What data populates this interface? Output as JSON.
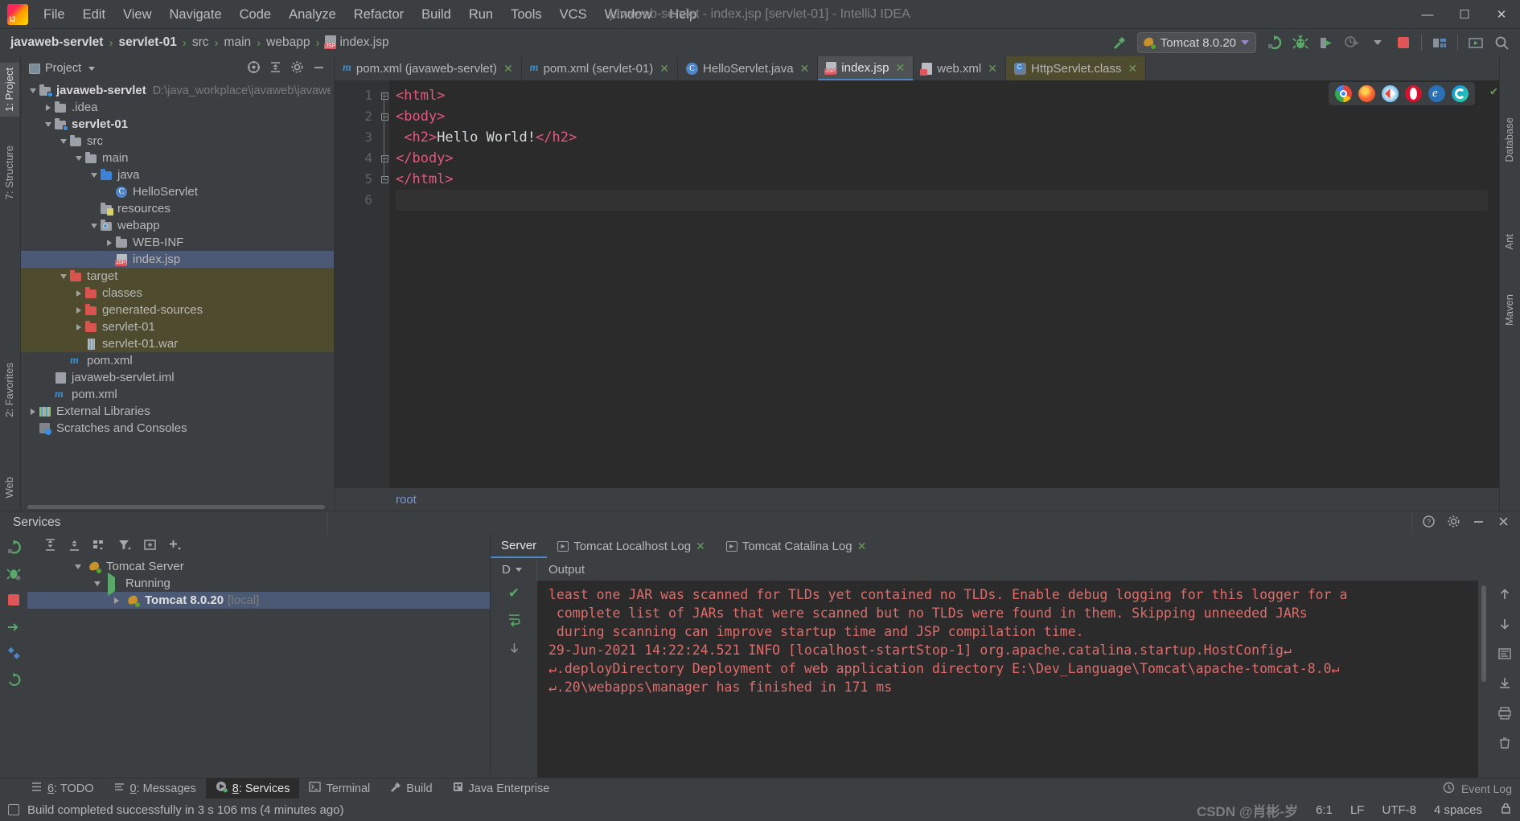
{
  "window": {
    "title": "javaweb-servlet - index.jsp [servlet-01] - IntelliJ IDEA",
    "minimize": "—",
    "maximize": "☐",
    "close": "✕"
  },
  "menubar": {
    "items": [
      {
        "label": "File"
      },
      {
        "label": "Edit"
      },
      {
        "label": "View"
      },
      {
        "label": "Navigate"
      },
      {
        "label": "Code"
      },
      {
        "label": "Analyze"
      },
      {
        "label": "Refactor"
      },
      {
        "label": "Build"
      },
      {
        "label": "Run"
      },
      {
        "label": "Tools"
      },
      {
        "label": "VCS"
      },
      {
        "label": "Window"
      },
      {
        "label": "Help"
      }
    ]
  },
  "breadcrumb": {
    "items": [
      "javaweb-servlet",
      "servlet-01",
      "src",
      "main",
      "webapp",
      "index.jsp"
    ],
    "separator": "›"
  },
  "toolbar": {
    "run_config": "Tomcat 8.0.20",
    "build_icon": "hammer-build-icon",
    "rerun_label": "↻",
    "debug_label": "🐞",
    "coverage_label": "▶",
    "profile_label": "▶",
    "stop_label": "■",
    "search_label": "🔍"
  },
  "project_panel": {
    "title": "Project",
    "tree": [
      {
        "indent": 0,
        "arrow": "down",
        "icon": "module-folder",
        "name": "javaweb-servlet",
        "bold": true,
        "path": "D:\\java_workplace\\javaweb\\javaweb-serv",
        "state": "normal"
      },
      {
        "indent": 1,
        "arrow": "right",
        "icon": "folder",
        "name": ".idea",
        "bold": false,
        "path": "",
        "state": "normal"
      },
      {
        "indent": 1,
        "arrow": "down",
        "icon": "module-folder",
        "name": "servlet-01",
        "bold": true,
        "path": "",
        "state": "normal"
      },
      {
        "indent": 2,
        "arrow": "down",
        "icon": "folder",
        "name": "src",
        "bold": false,
        "path": "",
        "state": "normal"
      },
      {
        "indent": 3,
        "arrow": "down",
        "icon": "folder",
        "name": "main",
        "bold": false,
        "path": "",
        "state": "normal"
      },
      {
        "indent": 4,
        "arrow": "down",
        "icon": "source-folder",
        "name": "java",
        "bold": false,
        "path": "",
        "state": "normal"
      },
      {
        "indent": 5,
        "arrow": "none",
        "icon": "java-class",
        "name": "HelloServlet",
        "bold": false,
        "path": "",
        "state": "normal"
      },
      {
        "indent": 4,
        "arrow": "none",
        "icon": "resources-folder",
        "name": "resources",
        "bold": false,
        "path": "",
        "state": "normal"
      },
      {
        "indent": 4,
        "arrow": "down",
        "icon": "webapp-folder",
        "name": "webapp",
        "bold": false,
        "path": "",
        "state": "normal"
      },
      {
        "indent": 5,
        "arrow": "right",
        "icon": "folder",
        "name": "WEB-INF",
        "bold": false,
        "path": "",
        "state": "normal"
      },
      {
        "indent": 5,
        "arrow": "none",
        "icon": "jsp-file",
        "name": "index.jsp",
        "bold": false,
        "path": "",
        "state": "selected"
      },
      {
        "indent": 2,
        "arrow": "down",
        "icon": "folder-red",
        "name": "target",
        "bold": false,
        "path": "",
        "state": "excluded"
      },
      {
        "indent": 3,
        "arrow": "right",
        "icon": "folder-red",
        "name": "classes",
        "bold": false,
        "path": "",
        "state": "excluded"
      },
      {
        "indent": 3,
        "arrow": "right",
        "icon": "folder-red",
        "name": "generated-sources",
        "bold": false,
        "path": "",
        "state": "excluded"
      },
      {
        "indent": 3,
        "arrow": "right",
        "icon": "folder-red",
        "name": "servlet-01",
        "bold": false,
        "path": "",
        "state": "excluded"
      },
      {
        "indent": 3,
        "arrow": "none",
        "icon": "war-file",
        "name": "servlet-01.war",
        "bold": false,
        "path": "",
        "state": "excluded"
      },
      {
        "indent": 2,
        "arrow": "none",
        "icon": "maven-file",
        "name": "pom.xml",
        "bold": false,
        "path": "",
        "state": "normal"
      },
      {
        "indent": 1,
        "arrow": "none",
        "icon": "iml-file",
        "name": "javaweb-servlet.iml",
        "bold": false,
        "path": "",
        "state": "normal"
      },
      {
        "indent": 1,
        "arrow": "none",
        "icon": "maven-file",
        "name": "pom.xml",
        "bold": false,
        "path": "",
        "state": "normal"
      },
      {
        "indent": 0,
        "arrow": "right",
        "icon": "libraries",
        "name": "External Libraries",
        "bold": false,
        "path": "",
        "state": "normal"
      },
      {
        "indent": 0,
        "arrow": "none",
        "icon": "scratches",
        "name": "Scratches and Consoles",
        "bold": false,
        "path": "",
        "state": "normal"
      }
    ]
  },
  "left_strip": {
    "tabs": [
      "1: Project",
      "7: Structure"
    ],
    "bottom_tabs": [
      "2: Favorites",
      "Web"
    ]
  },
  "right_strip": {
    "tabs": [
      "Database",
      "Ant",
      "Maven"
    ]
  },
  "editor": {
    "tabs": [
      {
        "label": "pom.xml (javaweb-servlet)",
        "icon": "maven-icon",
        "active": false,
        "readonly": false,
        "close": "✕"
      },
      {
        "label": "pom.xml (servlet-01)",
        "icon": "maven-icon",
        "active": false,
        "readonly": false,
        "close": "✕"
      },
      {
        "label": "HelloServlet.java",
        "icon": "java-class-icon",
        "active": false,
        "readonly": false,
        "close": "✕"
      },
      {
        "label": "index.jsp",
        "icon": "jsp-icon",
        "active": true,
        "readonly": false,
        "close": "✕"
      },
      {
        "label": "web.xml",
        "icon": "xml-icon",
        "active": false,
        "readonly": false,
        "close": "✕"
      },
      {
        "label": "HttpServlet.class",
        "icon": "class-file-icon",
        "active": false,
        "readonly": true,
        "close": "✕"
      }
    ],
    "line_numbers": [
      "1",
      "2",
      "3",
      "4",
      "5",
      "6"
    ],
    "lines": [
      {
        "parts": [
          {
            "t": "tag",
            "v": "<html>"
          }
        ]
      },
      {
        "parts": [
          {
            "t": "tag",
            "v": "<body>"
          }
        ]
      },
      {
        "parts": [
          {
            "t": "tag",
            "v": " <h2>"
          },
          {
            "t": "txt",
            "v": "Hello World!"
          },
          {
            "t": "tag",
            "v": "</h2>"
          }
        ]
      },
      {
        "parts": [
          {
            "t": "tag",
            "v": "</body>"
          }
        ]
      },
      {
        "parts": [
          {
            "t": "tag",
            "v": "</html>"
          }
        ]
      },
      {
        "parts": [
          {
            "t": "txt",
            "v": ""
          }
        ]
      }
    ],
    "footer_label": "root",
    "inspection_ok": "✔",
    "browsers": [
      {
        "name": "chrome-icon",
        "color": "#4285f4"
      },
      {
        "name": "firefox-icon",
        "color": "#ff7139"
      },
      {
        "name": "safari-icon",
        "color": "#4a9ae0"
      },
      {
        "name": "opera-icon",
        "color": "#d8112d"
      },
      {
        "name": "internet-explorer-icon",
        "color": "#1ebbee"
      },
      {
        "name": "edge-icon",
        "color": "#2b7cd3"
      }
    ]
  },
  "services": {
    "title": "Services",
    "tree": [
      {
        "indent": 0,
        "arrow": "down",
        "icon": "tomcat-icon",
        "name": "Tomcat Server",
        "bold": false,
        "selected": false,
        "suffix": ""
      },
      {
        "indent": 1,
        "arrow": "down",
        "icon": "running-icon",
        "name": "Running",
        "bold": false,
        "selected": false,
        "suffix": ""
      },
      {
        "indent": 2,
        "arrow": "right",
        "icon": "tomcat-run-icon",
        "name": "Tomcat 8.0.20",
        "bold": true,
        "selected": true,
        "suffix": "[local]"
      }
    ],
    "console_tabs": [
      {
        "label": "Server",
        "active": true,
        "closable": false,
        "icon": "",
        "close": "✕"
      },
      {
        "label": "Tomcat Localhost Log",
        "active": false,
        "closable": true,
        "icon": "console-icon",
        "close": "✕"
      },
      {
        "label": "Tomcat Catalina Log",
        "active": false,
        "closable": true,
        "icon": "console-icon",
        "close": "✕"
      }
    ],
    "output_dropdown": "D",
    "output_label": "Output",
    "console_lines": [
      "least one JAR was scanned for TLDs yet contained no TLDs. Enable debug logging for this logger for a",
      " complete list of JARs that were scanned but no TLDs were found in them. Skipping unneeded JARs",
      " during scanning can improve startup time and JSP compilation time.",
      "29-Jun-2021 14:22:24.521 INFO [localhost-startStop-1] org.apache.catalina.startup.HostConfig↵",
      "↵.deployDirectory Deployment of web application directory E:\\Dev_Language\\Tomcat\\apache-tomcat-8.0↵",
      "↵.20\\webapps\\manager has finished in 171 ms"
    ]
  },
  "toolwindow_bar": {
    "tabs": [
      {
        "num": "6",
        "label": ": TODO",
        "icon": "todo-icon",
        "active": false
      },
      {
        "num": "0",
        "label": ": Messages",
        "icon": "messages-icon",
        "active": false
      },
      {
        "num": "8",
        "label": ": Services",
        "icon": "services-icon",
        "active": true
      },
      {
        "num": "",
        "label": "Terminal",
        "icon": "terminal-icon",
        "active": false
      },
      {
        "num": "",
        "label": "Build",
        "icon": "build-icon",
        "active": false
      },
      {
        "num": "",
        "label": "Java Enterprise",
        "icon": "java-enterprise-icon",
        "active": false
      }
    ],
    "event_log": "Event Log"
  },
  "statusbar": {
    "message": "Build completed successfully in 3 s 106 ms (4 minutes ago)",
    "caret": "6:1",
    "line_sep": "LF",
    "encoding": "UTF-8",
    "indent": "4 spaces",
    "watermark": "CSDN @肖彬-岁"
  }
}
